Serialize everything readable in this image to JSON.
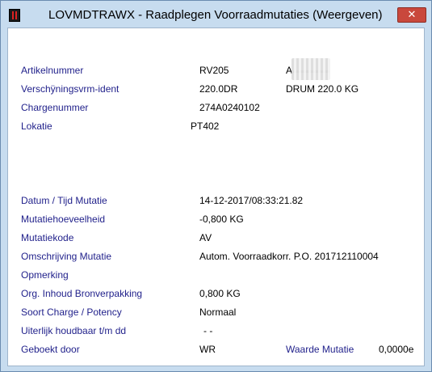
{
  "window": {
    "title": "LOVMDTRAWX - Raadplegen Voorraadmutaties (Weergeven)",
    "close_glyph": "✕"
  },
  "fields": {
    "artikelnummer": {
      "label": "Artikelnummer",
      "value": "RV205",
      "extra": "A"
    },
    "verschijning": {
      "label": "Verschÿningsvrm-ident",
      "value": "220.0DR",
      "extra": "DRUM 220.0 KG"
    },
    "charge": {
      "label": "Chargenummer",
      "value": "274A0240102"
    },
    "lokatie": {
      "label": "Lokatie",
      "value": "PT402"
    },
    "datum": {
      "label": "Datum / Tijd Mutatie",
      "value": "14-12-2017/08:33:21.82"
    },
    "hoeveelheid": {
      "label": "Mutatiehoeveelheid",
      "value": "-0,800 KG"
    },
    "code": {
      "label": "Mutatiekode",
      "value": "AV"
    },
    "omschrijving": {
      "label": "Omschrijving Mutatie",
      "value": "Autom. Voorraadkorr. P.O. 201712110004"
    },
    "opmerking": {
      "label": "Opmerking",
      "value": ""
    },
    "org_inhoud": {
      "label": "Org. Inhoud Bronverpakking",
      "value": "0,800 KG"
    },
    "soort": {
      "label": "Soort Charge / Potency",
      "value": "Normaal"
    },
    "houdbaar": {
      "label": "Uiterlijk houdbaar t/m dd",
      "value": "-  -"
    },
    "geboekt": {
      "label": "Geboekt door",
      "value": "WR"
    },
    "waarde": {
      "label": "Waarde Mutatie",
      "value": "0,0000e"
    }
  }
}
